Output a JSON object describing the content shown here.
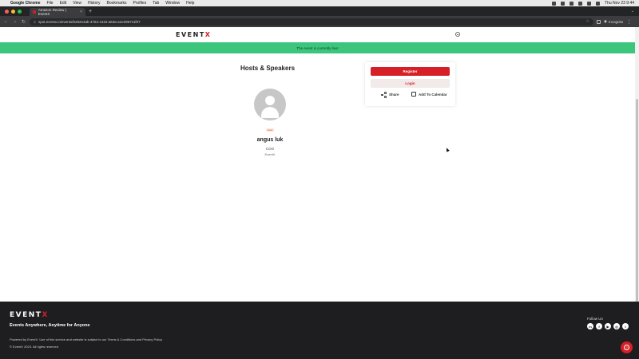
{
  "os_menubar": {
    "app": "Google Chrome",
    "items": [
      "File",
      "Edit",
      "View",
      "History",
      "Bookmarks",
      "Profiles",
      "Tab",
      "Window",
      "Help"
    ],
    "clock": "Thu Nov 23  9:44"
  },
  "browser": {
    "tab_title": "Amazon Review | EventX",
    "url": "spot.eventx.io/events/b282e4ab-4764-4115-a63a-a1e396711f27",
    "profile_label": "Incognito"
  },
  "header": {
    "logo_text": "EVENT",
    "logo_accent": "X"
  },
  "banner": {
    "text": "The event is currently live!",
    "color": "#3cc67d"
  },
  "hosts": {
    "title": "Hosts & Speakers",
    "speakers": [
      {
        "tag": "Host",
        "name": "angus luk",
        "role": "COO",
        "org": "EventX"
      }
    ]
  },
  "registration": {
    "register_label": "Register",
    "login_label": "Login",
    "share_label": "Share",
    "calendar_label": "Add To Calendar",
    "accent": "#d61f26"
  },
  "footer": {
    "logo_text": "EVENT",
    "logo_accent": "X",
    "tagline": "Events Anywhere, Anytime for Anyone",
    "powered": "Powered by EventX. Use of this service and website is subject to our Terms & Conditions and Privacy Policy",
    "copyright": "© EventX 2023. All rights reserved",
    "follow_label": "Follow Us",
    "socials": [
      "linkedin-icon",
      "facebook-icon",
      "youtube-icon",
      "instagram-icon",
      "twitter-icon"
    ],
    "social_glyphs": [
      "in",
      "f",
      "▶",
      "◎",
      "t"
    ]
  }
}
